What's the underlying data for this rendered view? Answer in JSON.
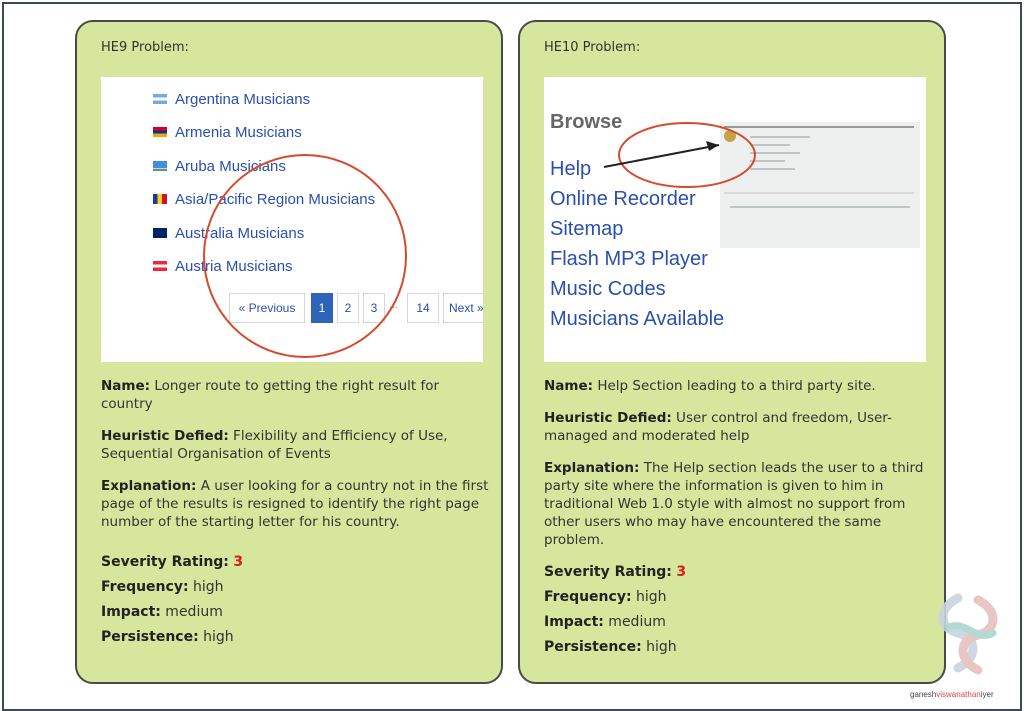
{
  "he9": {
    "title": "HE9 Problem:",
    "screenshot": {
      "countries": [
        {
          "label": "Argentina Musicians"
        },
        {
          "label": "Armenia Musicians"
        },
        {
          "label": "Aruba Musicians"
        },
        {
          "label": "Asia/Pacific Region Musicians"
        },
        {
          "label": "Australia Musicians"
        },
        {
          "label": "Austria Musicians"
        }
      ],
      "pager": {
        "prev": "« Previous",
        "p1": "1",
        "p2": "2",
        "p3": "3",
        "dots": "...",
        "p14": "14",
        "next": "Next »"
      }
    },
    "name_label": "Name:",
    "name_value": " Longer route to getting the right result for country",
    "heuristic_label": "Heuristic Defied:",
    "heuristic_value": " Flexibility and Efficiency of Use, Sequential Organisation of Events",
    "explanation_label": "Explanation:",
    "explanation_value": " A user looking for a country not in the first page of the results is resigned to identify the right page number of the starting letter for his country.",
    "severity_label": "Severity Rating:",
    "severity_value": "3",
    "frequency_label": "Frequency:",
    "frequency_value": " high",
    "impact_label": "Impact:",
    "impact_value": " medium",
    "persistence_label": "Persistence:",
    "persistence_value": " high"
  },
  "he10": {
    "title": "HE10 Problem:",
    "screenshot": {
      "browse": "Browse",
      "links": [
        "Help",
        "Online Recorder",
        "Sitemap",
        "Flash MP3 Player",
        "Music Codes",
        "Musicians Available"
      ]
    },
    "name_label": "Name:",
    "name_value": " Help Section leading to a third party site.",
    "heuristic_label": "Heuristic Defied:",
    "heuristic_value": " User control and freedom, User-managed and moderated help",
    "explanation_label": "Explanation:",
    "explanation_value": " The Help section leads the user to a third party site where the information is given to him in traditional Web 1.0 style with almost no support from other users who may have encountered the same problem.",
    "severity_label": "Severity Rating:",
    "severity_value": "3",
    "frequency_label": "Frequency:",
    "frequency_value": " high",
    "impact_label": "Impact:",
    "impact_value": " medium",
    "persistence_label": "Persistence:",
    "persistence_value": " high"
  },
  "credit": {
    "part1": "ganesh",
    "part2": "viswanathan",
    "part3": "iyer"
  },
  "colors": {
    "card_bg": "#d6e69c",
    "severity": "#e01b1b",
    "link": "#2a4fb0",
    "circle": "#d74a2c"
  }
}
